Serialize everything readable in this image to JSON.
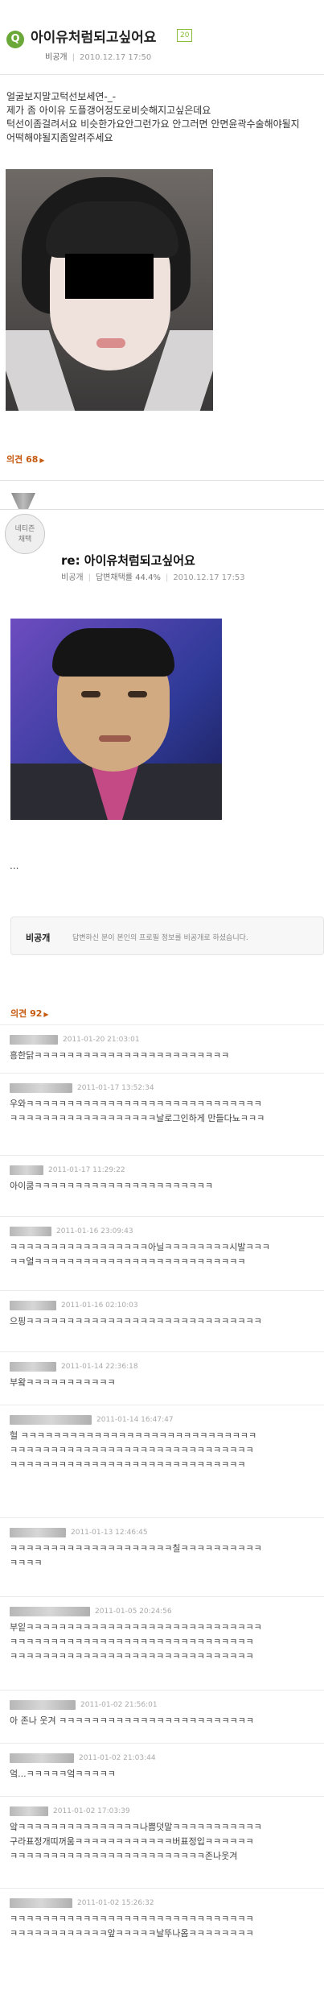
{
  "question": {
    "icon": "Q",
    "title": "아이유처럼되고싶어요",
    "badge": "20",
    "author": "비공개",
    "date": "2010.12.17 17:50",
    "body": [
      "얼굴보지말고턱선보세연-_-",
      "제가 좀 아이유 도플갱어정도로비슷해지고싶은데요",
      "턱선이좀걸려서요 비슷한가요안그런가요 안그러면 안면윤곽수술해야될지",
      "어떡해야될지좀알려주세요"
    ],
    "comments_label": "의견 68",
    "comments_arrow": "▶"
  },
  "answer": {
    "badge_line1": "네티즌",
    "badge_line2": "채택",
    "title": "re: 아이유처럼되고싶어요",
    "author": "비공개",
    "adoption": "답변채택률 44.4%",
    "date": "2010.12.17 17:53",
    "ellipsis": "...",
    "private_title": "비공개",
    "private_text": "답변하신 분이 본인의 프로필 정보를 비공개로 하셨습니다."
  },
  "comments": {
    "count_label": "의견 92",
    "arrow": "▶",
    "items": [
      {
        "date": "2011-01-20 21:03:01",
        "lines": [
          "흥한닭ㅋㅋㅋㅋㅋㅋㅋㅋㅋㅋㅋㅋㅋㅋㅋㅋㅋㅋㅋㅋㅋㅋㅋㅋ"
        ]
      },
      {
        "date": "2011-01-17 13:52:34",
        "lines": [
          "우와ㅋㅋㅋㅋㅋㅋㅋㅋㅋㅋㅋㅋㅋㅋㅋㅋㅋㅋㅋㅋㅋㅋㅋㅋㅋㅋㅋㅋㅋ",
          "ㅋㅋㅋㅋㅋㅋㅋㅋㅋㅋㅋㅋㅋㅋㅋㅋㅋㅋ날로그인하게 만들다뇨ㅋㅋㅋ"
        ]
      },
      {
        "date": "2011-01-17 11:29:22",
        "lines": [
          "아이쿰ㅋㅋㅋㅋㅋㅋㅋㅋㅋㅋㅋㅋㅋㅋㅋㅋㅋㅋㅋㅋㅋㅋ"
        ]
      },
      {
        "date": "2011-01-16 23:09:43",
        "lines": [
          "ㅋㅋㅋㅋㅋㅋㅋㅋㅋㅋㅋㅋㅋㅋㅋㅋㅋ아닐ㅋㅋㅋㅋㅋㅋㅋㅋ시발ㅋㅋㅋ",
          "ㅋㅋ얼ㅋㅋㅋㅋㅋㅋㅋㅋㅋㅋㅋㅋㅋㅋㅋㅋㅋㅋㅋㅋㅋㅋㅋㅋㅋㅋ"
        ]
      },
      {
        "date": "2011-01-16 02:10:03",
        "lines": [
          "으핑ㅋㅋㅋㅋㅋㅋㅋㅋㅋㅋㅋㅋㅋㅋㅋㅋㅋㅋㅋㅋㅋㅋㅋㅋㅋㅋㅋㅋㅋ"
        ]
      },
      {
        "date": "2011-01-14 22:36:18",
        "lines": [
          "부왘ㅋㅋㅋㅋㅋㅋㅋㅋㅋㅋㅋ"
        ]
      },
      {
        "date": "2011-01-14 16:47:47",
        "lines": [
          "헐 ㅋㅋㅋㅋㅋㅋㅋㅋㅋㅋㅋㅋㅋㅋㅋㅋㅋㅋㅋㅋㅋㅋㅋㅋㅋㅋㅋㅋㅋ",
          "ㅋㅋㅋㅋㅋㅋㅋㅋㅋㅋㅋㅋㅋㅋㅋㅋㅋㅋㅋㅋㅋㅋㅋㅋㅋㅋㅋㅋㅋㅋ",
          "ㅋㅋㅋㅋㅋㅋㅋㅋㅋㅋㅋㅋㅋㅋㅋㅋㅋㅋㅋㅋㅋㅋㅋㅋㅋㅋㅋㅋㅋ"
        ]
      },
      {
        "date": "2011-01-13 12:46:45",
        "lines": [
          "ㅋㅋㅋㅋㅋㅋㅋㅋㅋㅋㅋㅋㅋㅋㅋㅋㅋㅋㅋㅋ칠ㅋㅋㅋㅋㅋㅋㅋㅋㅋㅋ",
          "ㅋㅋㅋㅋ"
        ]
      },
      {
        "date": "2011-01-05 20:24:56",
        "lines": [
          "부잍ㅋㅋㅋㅋㅋㅋㅋㅋㅋㅋㅋㅋㅋㅋㅋㅋㅋㅋㅋㅋㅋㅋㅋㅋㅋㅋㅋㅋㅋ",
          "ㅋㅋㅋㅋㅋㅋㅋㅋㅋㅋㅋㅋㅋㅋㅋㅋㅋㅋㅋㅋㅋㅋㅋㅋㅋㅋㅋㅋㅋㅋ",
          "ㅋㅋㅋㅋㅋㅋㅋㅋㅋㅋㅋㅋㅋㅋㅋㅋㅋㅋㅋㅋㅋㅋㅋㅋㅋㅋㅋㅋㅋㅋ"
        ]
      },
      {
        "date": "2011-01-02 21:56:01",
        "lines": [
          "아 존나 웃겨 ㅋㅋㅋㅋㅋㅋㅋㅋㅋㅋㅋㅋㅋㅋㅋㅋㅋㅋㅋㅋㅋㅋㅋㅋ"
        ]
      },
      {
        "date": "2011-01-02 21:03:44",
        "lines": [
          "엌...ㅋㅋㅋㅋㅋ엌ㅋㅋㅋㅋㅋ"
        ]
      },
      {
        "date": "2011-01-02 17:03:39",
        "lines": [
          "앜ㅋㅋㅋㅋㅋㅋㅋㅋㅋㅋㅋㅋㅋㅋㅋ나쁨덧말ㅋㅋㅋㅋㅋㅋㅋㅋㅋㅋㅋ",
          "구라표정개띠꺼움ㅋㅋㅋㅋㅋㅋㅋㅋㅋㅋㅋㅋ버표정입ㅋㅋㅋㅋㅋㅋ",
          "ㅋㅋㅋㅋㅋㅋㅋㅋㅋㅋㅋㅋㅋㅋㅋㅋㅋㅋㅋㅋㅋㅋㅋㅋ존나웃겨"
        ]
      },
      {
        "date": "2011-01-02 15:26:32",
        "lines": [
          "ㅋㅋㅋㅋㅋㅋㅋㅋㅋㅋㅋㅋㅋㅋㅋㅋㅋㅋㅋㅋㅋㅋㅋㅋㅋㅋㅋㅋㅋㅋ",
          "ㅋㅋㅋㅋㅋㅋㅋㅋㅋㅋㅋㅋ앞ㅋㅋㅋㅋㅋ날뚜나옴ㅋㅋㅋㅋㅋㅋㅋㅋ"
        ]
      }
    ]
  },
  "colors": {
    "accent_green": "#6aa83a",
    "comment_orange": "#c55a11"
  }
}
